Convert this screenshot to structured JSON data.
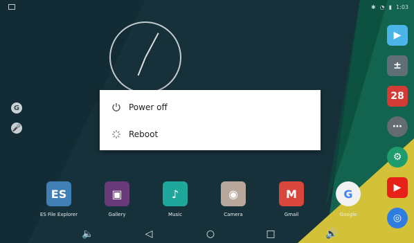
{
  "status_bar": {
    "time": "1:03",
    "icons": [
      "screenshot-icon",
      "bluetooth-icon",
      "wifi-icon",
      "battery-icon"
    ]
  },
  "clock_widget": {
    "hour_angle_deg": 202,
    "minute_angle_deg": 28
  },
  "left_icons": [
    {
      "name": "google-search-icon",
      "glyph": "G"
    },
    {
      "name": "microphone-icon",
      "glyph": "🎤"
    }
  ],
  "dialog": {
    "items": [
      {
        "label": "Power off",
        "icon": "power-icon"
      },
      {
        "label": "Reboot",
        "icon": "reboot-icon"
      }
    ]
  },
  "dock_apps": [
    {
      "label": "ES File Explorer",
      "icon": "es-file-explorer-icon",
      "color": "#3f7fb6",
      "glyph": "ES"
    },
    {
      "label": "Gallery",
      "icon": "gallery-icon",
      "color": "#6a3b7a",
      "glyph": "▣"
    },
    {
      "label": "Music",
      "icon": "music-icon",
      "color": "#1fa79b",
      "glyph": "♪"
    },
    {
      "label": "Camera",
      "icon": "camera-icon",
      "color": "#b7a89b",
      "glyph": "◉"
    },
    {
      "label": "Gmail",
      "icon": "gmail-icon",
      "color": "#d9463b",
      "glyph": "M"
    },
    {
      "label": "Google",
      "icon": "google-icon",
      "color": "#f2f2f2",
      "glyph": "G"
    }
  ],
  "right_icons": [
    {
      "name": "play-store-icon",
      "color": "#4bb4e9",
      "glyph": "▶"
    },
    {
      "name": "calculator-icon",
      "color": "#5f6f75",
      "glyph": "±"
    },
    {
      "name": "calendar-icon",
      "color": "#d23b36",
      "glyph": "28"
    },
    {
      "name": "all-apps-icon",
      "color": "#636c70",
      "glyph": "⋯"
    },
    {
      "name": "settings-icon",
      "color": "#1f9c6e",
      "glyph": "⚙"
    },
    {
      "name": "youtube-icon",
      "color": "#e62117",
      "glyph": "▶"
    },
    {
      "name": "chrome-icon",
      "color": "#2f7de1",
      "glyph": "◎"
    }
  ],
  "nav_bar": [
    {
      "name": "volume-down-icon",
      "glyph": "🔈"
    },
    {
      "name": "back-icon",
      "glyph": "◁"
    },
    {
      "name": "home-icon",
      "glyph": "○"
    },
    {
      "name": "recents-icon",
      "glyph": "□"
    },
    {
      "name": "volume-up-icon",
      "glyph": "🔊"
    }
  ],
  "colors": {
    "background_dark": "#17313b",
    "wallpaper_yellow": "#d4c13a",
    "wallpaper_green": "#12644e",
    "dialog_bg": "#ffffff"
  }
}
